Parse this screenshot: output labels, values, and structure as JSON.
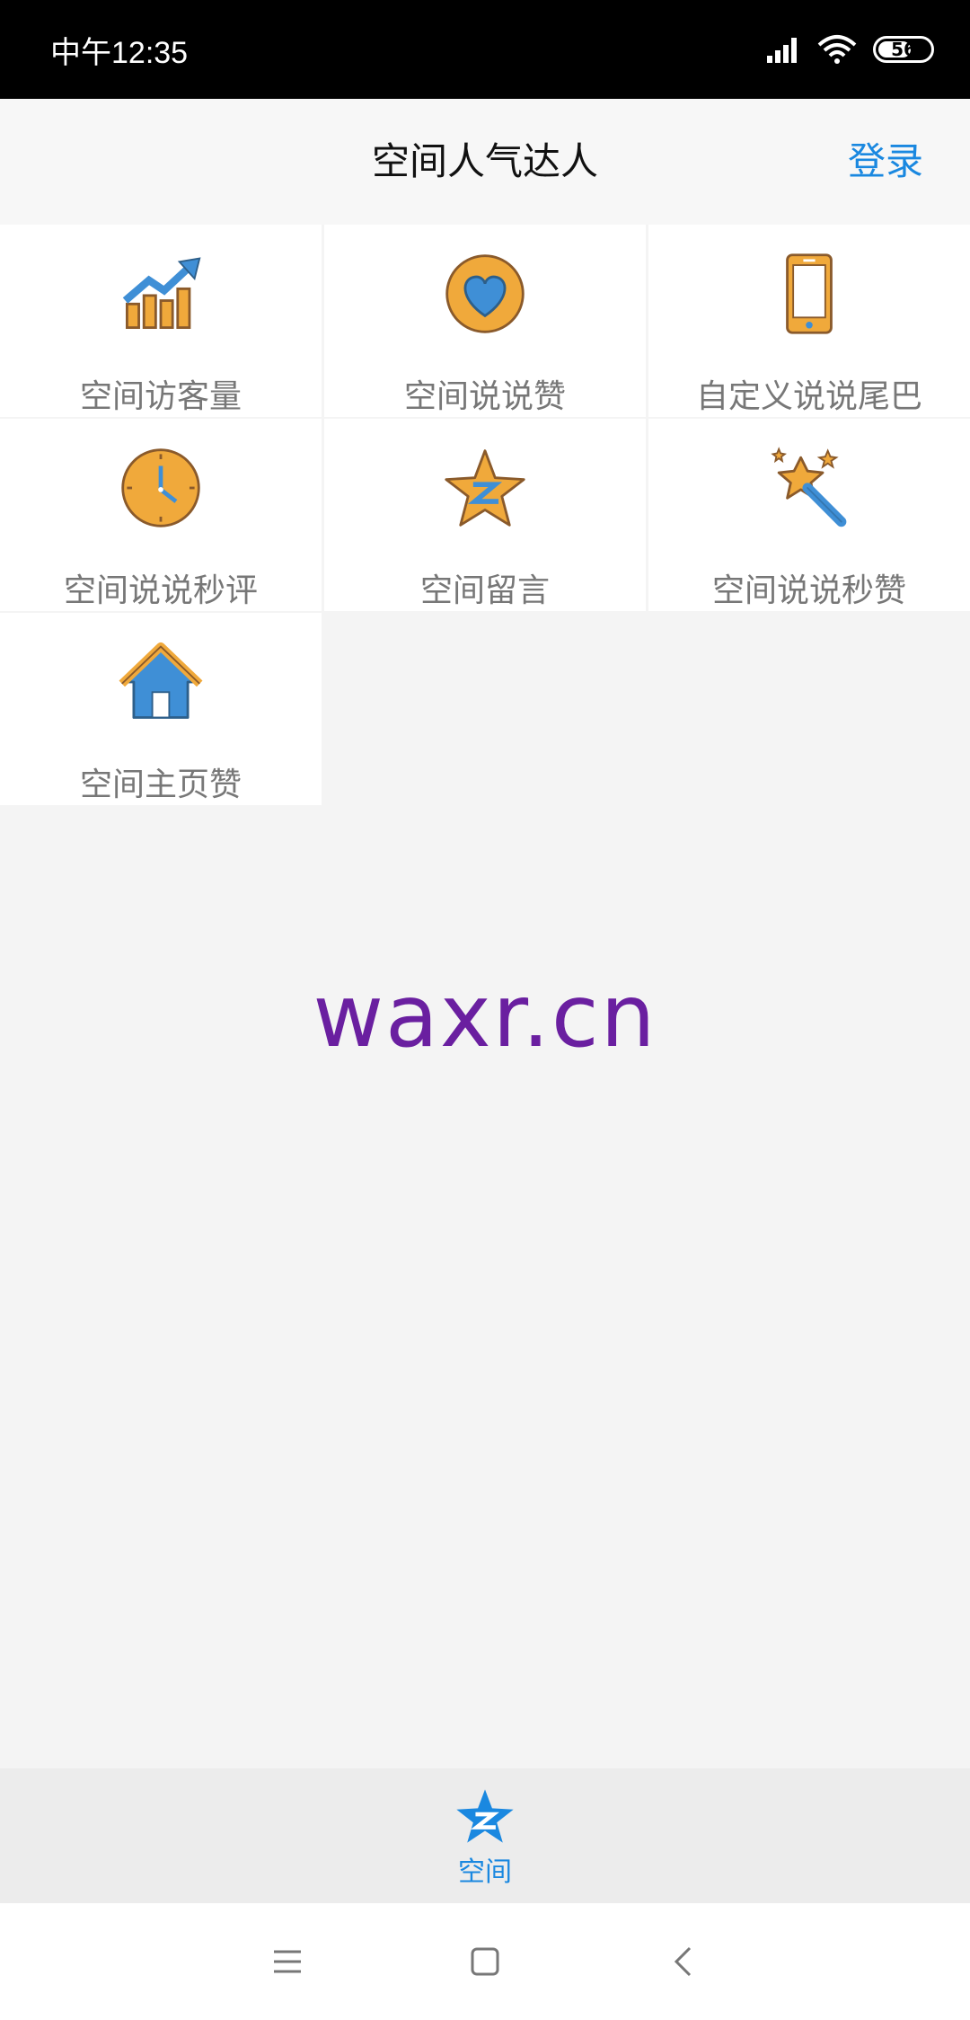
{
  "status_bar": {
    "time": "中午12:35",
    "battery": "56"
  },
  "header": {
    "title": "空间人气达人",
    "login_label": "登录"
  },
  "grid": {
    "items": [
      {
        "label": "空间访客量",
        "icon": "chart-up-icon"
      },
      {
        "label": "空间说说赞",
        "icon": "heart-icon"
      },
      {
        "label": "自定义说说尾巴",
        "icon": "phone-icon"
      },
      {
        "label": "空间说说秒评",
        "icon": "clock-icon"
      },
      {
        "label": "空间留言",
        "icon": "qzone-star-icon"
      },
      {
        "label": "空间说说秒赞",
        "icon": "magic-wand-icon"
      },
      {
        "label": "空间主页赞",
        "icon": "home-icon"
      }
    ]
  },
  "watermark": "waxr.cn",
  "tabbar": {
    "tab_label": "空间"
  },
  "colors": {
    "accent": "#1a88e0",
    "icon_orange": "#f0a93b",
    "icon_blue": "#3f8fd6",
    "watermark": "#6a1fa0"
  }
}
